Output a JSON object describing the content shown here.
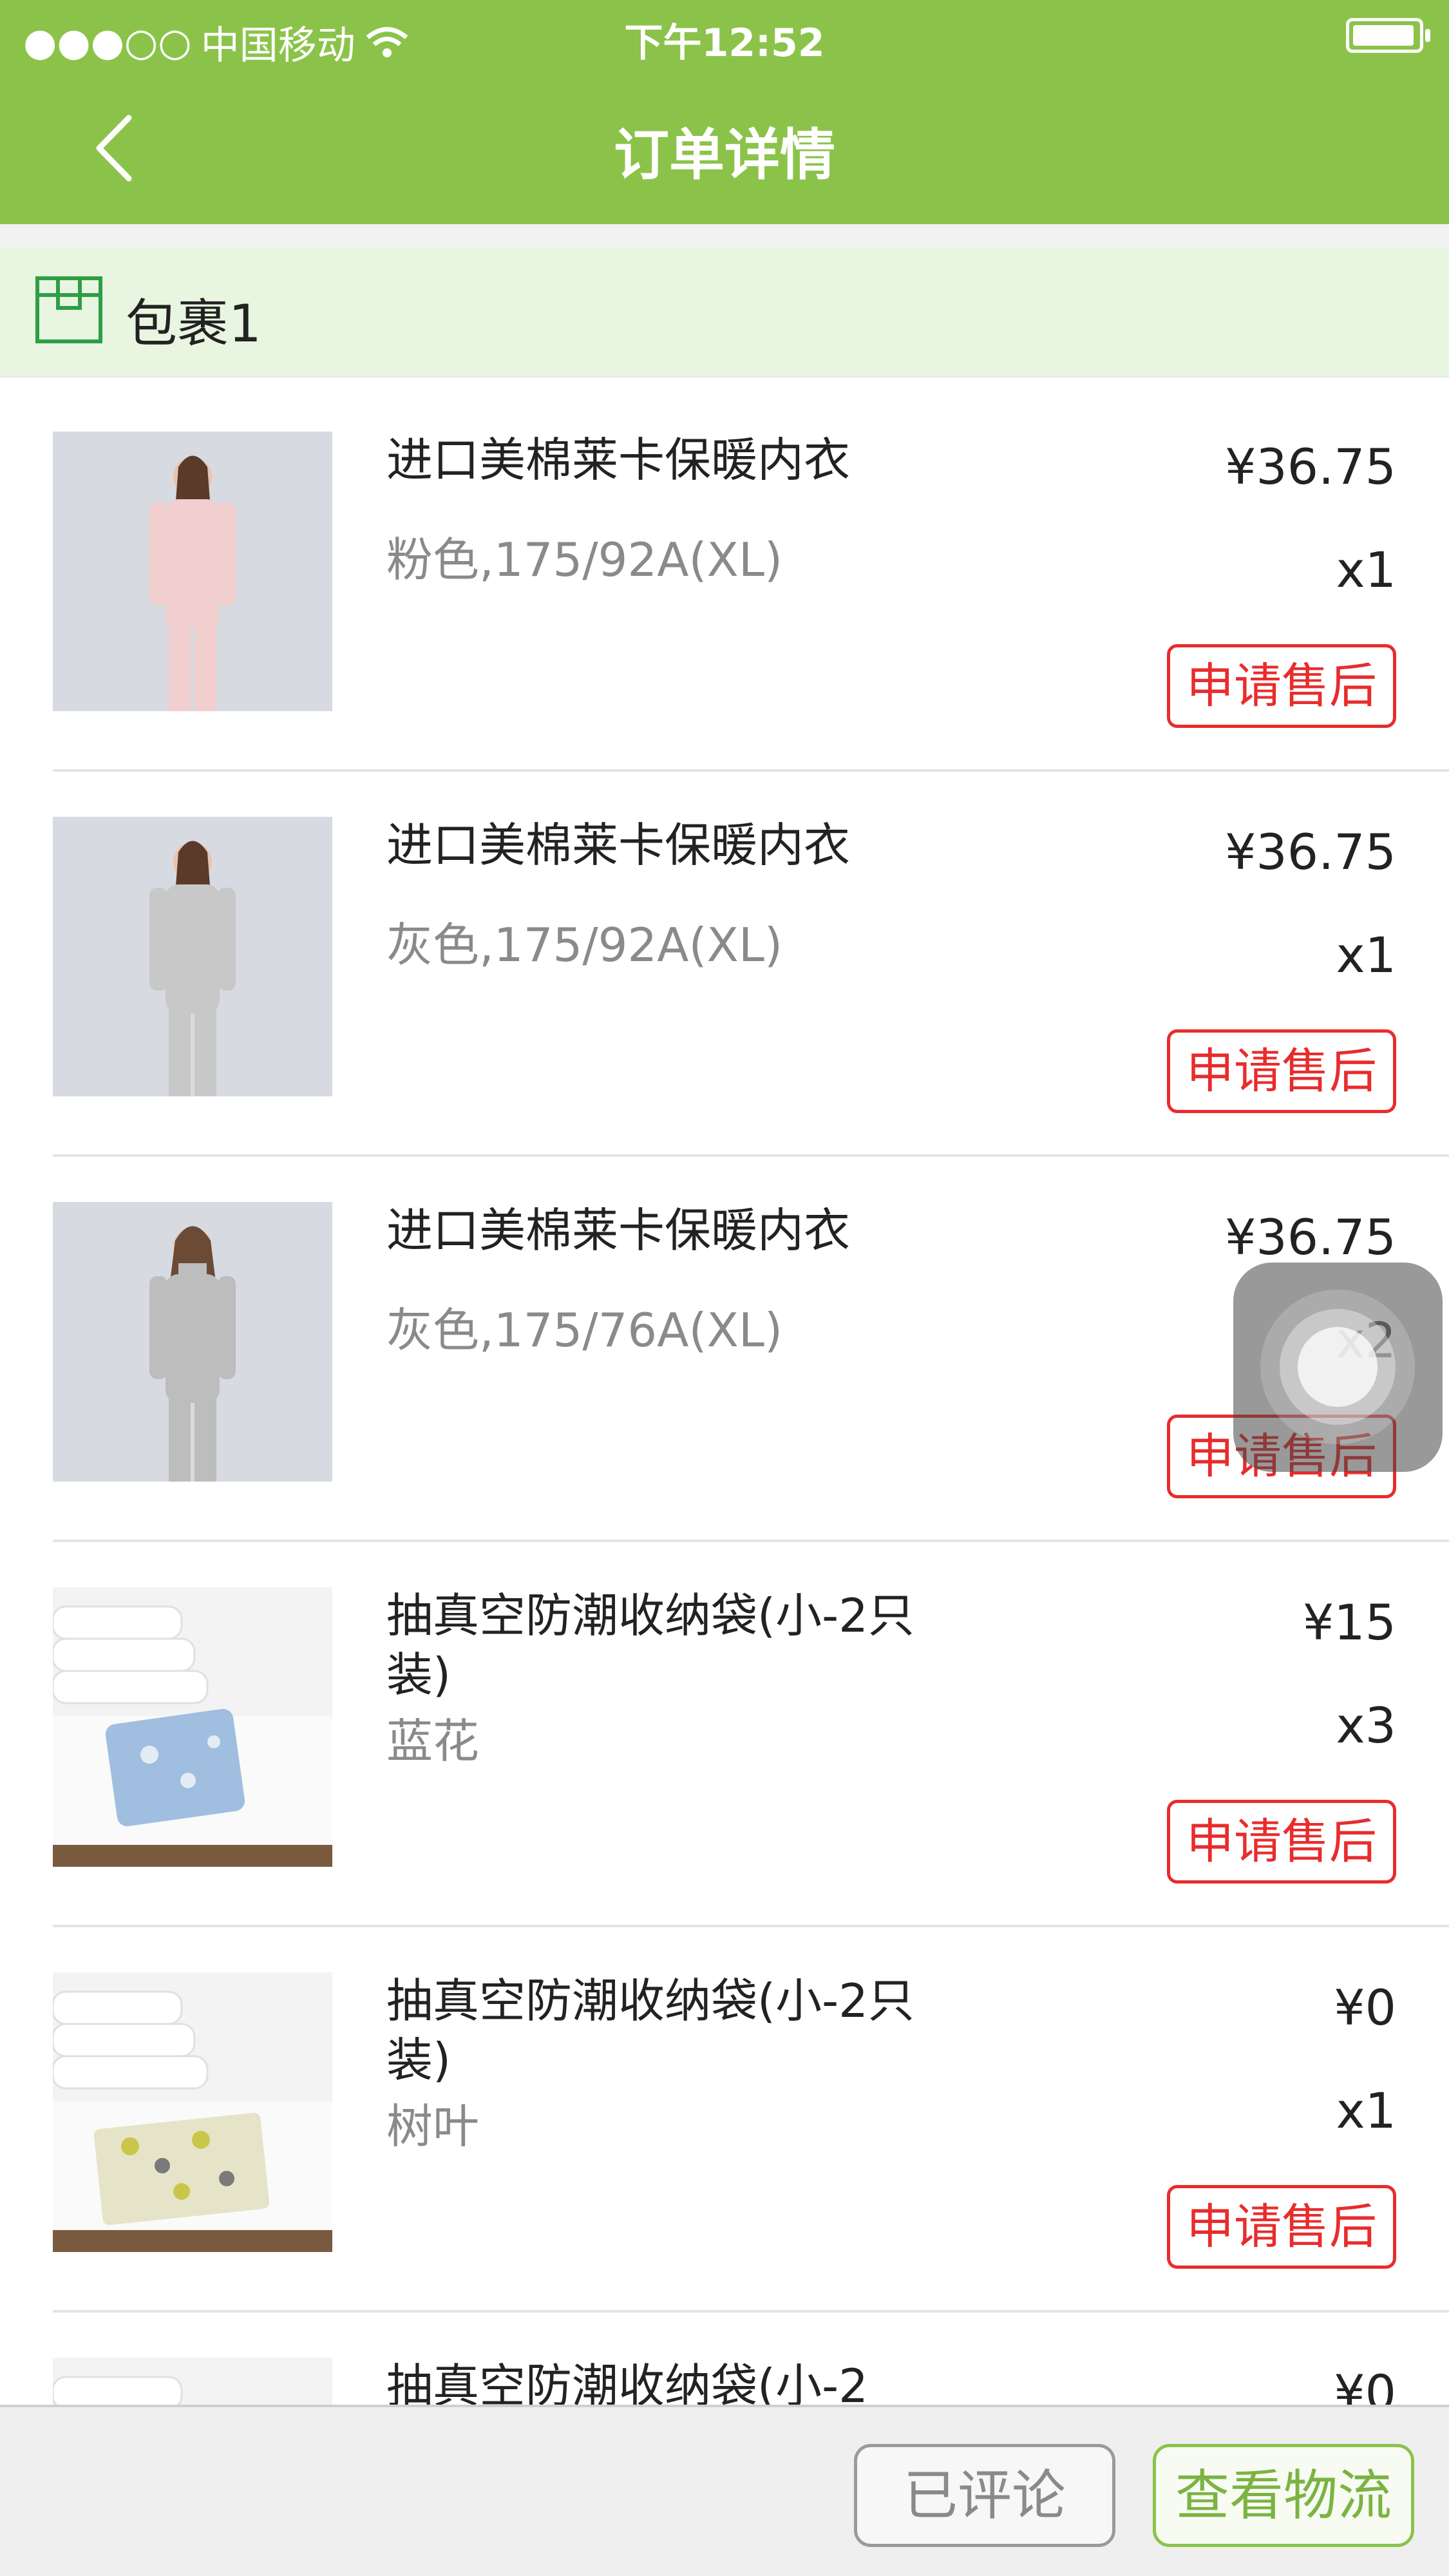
{
  "status_bar": {
    "signal": "●●●○○",
    "carrier": "中国移动",
    "time": "下午12:52"
  },
  "header": {
    "title": "订单详情"
  },
  "package": {
    "label": "包裹1"
  },
  "items": [
    {
      "title": "进口美棉莱卡保暖内衣",
      "spec": "粉色,175/92A(XL)",
      "price": "¥36.75",
      "qty": "x1",
      "button": "申请售后",
      "image_color": "#f2cfcf"
    },
    {
      "title": "进口美棉莱卡保暖内衣",
      "spec": "灰色,175/92A(XL)",
      "price": "¥36.75",
      "qty": "x1",
      "button": "申请售后",
      "image_color": "#c8c8c8"
    },
    {
      "title": "进口美棉莱卡保暖内衣",
      "spec": "灰色,175/76A(XL)",
      "price": "¥36.75",
      "qty": "x2",
      "button": "申请售后",
      "image_color": "#bdbdbd"
    },
    {
      "title": "抽真空防潮收纳袋(小-2只装)",
      "spec": "蓝花",
      "price": "¥15",
      "qty": "x3",
      "button": "申请售后",
      "image_color": "#8fb3d9"
    },
    {
      "title": "抽真空防潮收纳袋(小-2只装)",
      "spec": "树叶",
      "price": "¥0",
      "qty": "x1",
      "button": "申请售后",
      "image_color": "#c9c74a"
    },
    {
      "title": "抽真空防潮收纳袋(小-2",
      "spec": "",
      "price": "¥0",
      "qty": "",
      "button": "",
      "image_color": "#e0e0e0"
    }
  ],
  "bottom_bar": {
    "reviewed_label": "已评论",
    "logistics_label": "查看物流"
  },
  "colors": {
    "header_green": "#8bc34a",
    "package_bg": "#e8f5e0",
    "aftersale_red": "#e82c2c"
  }
}
